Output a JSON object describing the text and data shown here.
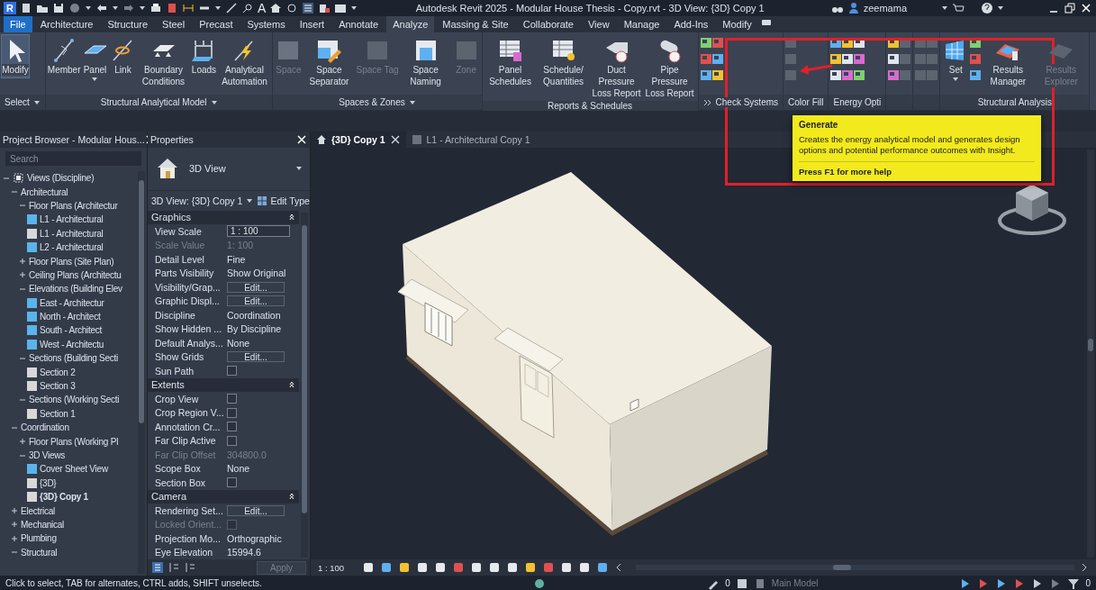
{
  "window": {
    "logo": "R",
    "text_tool": "A",
    "title": "Autodesk Revit 2025 - Modular House Thesis - Copy.rvt - 3D View: {3D} Copy 1",
    "user": "zeemama"
  },
  "menu_tabs": [
    {
      "label": "File",
      "kind": "file",
      "selected": false
    },
    {
      "label": "Architecture",
      "kind": "tab",
      "selected": false
    },
    {
      "label": "Structure",
      "kind": "tab",
      "selected": false
    },
    {
      "label": "Steel",
      "kind": "tab",
      "selected": false
    },
    {
      "label": "Precast",
      "kind": "tab",
      "selected": false
    },
    {
      "label": "Systems",
      "kind": "tab",
      "selected": false
    },
    {
      "label": "Insert",
      "kind": "tab",
      "selected": false
    },
    {
      "label": "Annotate",
      "kind": "tab",
      "selected": false
    },
    {
      "label": "Analyze",
      "kind": "tab",
      "selected": true
    },
    {
      "label": "Massing & Site",
      "kind": "tab",
      "selected": false
    },
    {
      "label": "Collaborate",
      "kind": "tab",
      "selected": false
    },
    {
      "label": "View",
      "kind": "tab",
      "selected": false
    },
    {
      "label": "Manage",
      "kind": "tab",
      "selected": false
    },
    {
      "label": "Add-Ins",
      "kind": "tab",
      "selected": false
    },
    {
      "label": "Modify",
      "kind": "tab",
      "selected": false
    }
  ],
  "ribbon": {
    "panels": [
      {
        "label": "Select",
        "menu": true,
        "expander": false,
        "items": [
          {
            "kind": "large",
            "label": "Modify",
            "selected": true,
            "disabled": false,
            "split": false
          }
        ]
      },
      {
        "label": "Structural Analytical Model",
        "menu": true,
        "expander": false,
        "items": [
          {
            "kind": "large",
            "label": "Member",
            "selected": false,
            "disabled": false,
            "split": false
          },
          {
            "kind": "large",
            "label": "Panel",
            "selected": false,
            "disabled": false,
            "split": true
          },
          {
            "kind": "large",
            "label": "Link",
            "selected": false,
            "disabled": false,
            "split": false
          },
          {
            "kind": "large",
            "label": "Boundary Conditions",
            "selected": false,
            "disabled": false,
            "split": false
          },
          {
            "kind": "large",
            "label": "Loads",
            "selected": false,
            "disabled": false,
            "split": false
          },
          {
            "kind": "large",
            "label": "Analytical Automation",
            "selected": false,
            "disabled": false,
            "split": false
          }
        ]
      },
      {
        "label": "Spaces & Zones",
        "menu": true,
        "expander": false,
        "items": [
          {
            "kind": "large",
            "label": "Space",
            "selected": false,
            "disabled": true,
            "split": false
          },
          {
            "kind": "large",
            "label": "Space Separator",
            "selected": false,
            "disabled": false,
            "split": false
          },
          {
            "kind": "large",
            "label": "Space Tag",
            "selected": false,
            "disabled": true,
            "split": false
          },
          {
            "kind": "large",
            "label": "Space Naming",
            "selected": false,
            "disabled": false,
            "split": false
          },
          {
            "kind": "large",
            "label": "Zone",
            "selected": false,
            "disabled": true,
            "split": false
          }
        ]
      },
      {
        "label": "Reports & Schedules",
        "menu": false,
        "expander": false,
        "items": [
          {
            "kind": "large",
            "label": "Panel Schedules",
            "selected": false,
            "disabled": false,
            "split": false
          },
          {
            "kind": "large",
            "label": "Schedule/ Quantities",
            "selected": false,
            "disabled": false,
            "split": false
          },
          {
            "kind": "large",
            "label": "Duct Pressure Loss Report",
            "selected": false,
            "disabled": false,
            "split": false
          },
          {
            "kind": "large",
            "label": "Pipe Pressure Loss Report",
            "selected": false,
            "disabled": false,
            "split": false
          }
        ]
      },
      {
        "label": "Check Systems",
        "menu": false,
        "expander": true,
        "items": [
          {
            "kind": "stack",
            "disabled": false
          },
          {
            "kind": "stack",
            "disabled": false
          }
        ]
      },
      {
        "label": "Color Fill",
        "menu": false,
        "expander": false,
        "items": [
          {
            "kind": "stack",
            "disabled": true
          }
        ]
      },
      {
        "label": "Energy Opti",
        "menu": false,
        "expander": false,
        "items": [
          {
            "kind": "stack",
            "disabled": false
          },
          {
            "kind": "stack",
            "disabled": false
          },
          {
            "kind": "stack",
            "disabled": false
          }
        ]
      },
      {
        "menu": false,
        "expander": false,
        "items": [
          {
            "kind": "stack",
            "disabled": false
          },
          {
            "kind": "stack",
            "disabled": true
          }
        ]
      },
      {
        "menu": false,
        "expander": false,
        "items": [
          {
            "kind": "stack",
            "disabled": true
          },
          {
            "kind": "stack",
            "disabled": true
          }
        ]
      },
      {
        "label": "Structural Analysis",
        "menu": false,
        "expander": false,
        "items": [
          {
            "kind": "large",
            "label": "Set",
            "selected": false,
            "disabled": false,
            "split": true
          },
          {
            "kind": "stack",
            "disabled": false
          },
          {
            "kind": "large",
            "label": "Results Manager",
            "selected": false,
            "disabled": false,
            "split": false
          },
          {
            "kind": "large",
            "label": "Results Explorer",
            "selected": false,
            "disabled": true,
            "split": false
          }
        ]
      }
    ]
  },
  "tooltip": {
    "title": "Generate",
    "body": "Creates the energy analytical model and generates design options and potential performance outcomes with Insight.",
    "help": "Press F1 for more help"
  },
  "project_browser": {
    "title": "Project Browser - Modular Hous...",
    "search_placeholder": "Search",
    "tree": [
      {
        "label": "Views (Discipline)",
        "expanded": true,
        "children": [
          {
            "label": "Architectural",
            "expanded": true,
            "children": [
              {
                "label": "Floor Plans (Architectur",
                "expanded": true,
                "children": [
                  {
                    "label": "L1 - Architectural",
                    "color": "#5ab4ec",
                    "active": false
                  },
                  {
                    "label": "L1 - Architectural",
                    "color": "#d8d8d8",
                    "active": false
                  },
                  {
                    "label": "L2 - Architectural",
                    "color": "#5ab4ec",
                    "active": false
                  }
                ]
              },
              {
                "label": "Floor Plans (Site Plan)",
                "expanded": false
              },
              {
                "label": "Ceiling Plans (Architectu",
                "expanded": false
              },
              {
                "label": "Elevations (Building Elev",
                "expanded": true,
                "children": [
                  {
                    "label": "East - Architectur",
                    "color": "#5ab4ec",
                    "active": false
                  },
                  {
                    "label": "North - Architect",
                    "color": "#5ab4ec",
                    "active": false
                  },
                  {
                    "label": "South - Architect",
                    "color": "#5ab4ec",
                    "active": false
                  },
                  {
                    "label": "West - Architectu",
                    "color": "#5ab4ec",
                    "active": false
                  }
                ]
              },
              {
                "label": "Sections (Building Secti",
                "expanded": true,
                "children": [
                  {
                    "label": "Section 2",
                    "color": "#d8d8d8",
                    "active": false
                  },
                  {
                    "label": "Section 3",
                    "color": "#d8d8d8",
                    "active": false
                  }
                ]
              },
              {
                "label": "Sections (Working Secti",
                "expanded": true,
                "children": [
                  {
                    "label": "Section 1",
                    "color": "#d8d8d8",
                    "active": false
                  }
                ]
              }
            ]
          },
          {
            "label": "Coordination",
            "expanded": true,
            "children": [
              {
                "label": "Floor Plans (Working Pl",
                "expanded": false
              },
              {
                "label": "3D Views",
                "expanded": true,
                "children": [
                  {
                    "label": "Cover Sheet View",
                    "color": "#5ab4ec",
                    "active": false
                  },
                  {
                    "label": "{3D}",
                    "color": "#d8d8d8",
                    "active": false
                  },
                  {
                    "label": "{3D} Copy 1",
                    "color": "#d8d8d8",
                    "active": true
                  }
                ]
              }
            ]
          },
          {
            "label": "Electrical",
            "expanded": false
          },
          {
            "label": "Mechanical",
            "expanded": false
          },
          {
            "label": "Plumbing",
            "expanded": false
          },
          {
            "label": "Structural",
            "expanded": true
          }
        ]
      }
    ]
  },
  "properties": {
    "title": "Properties",
    "type_name": "3D View",
    "instance": "3D View: {3D} Copy 1",
    "edit_type": "Edit Type",
    "groups": [
      {
        "title": "Graphics",
        "rows": [
          {
            "label": "View Scale",
            "value": "1 : 100",
            "kind": "field",
            "disabled": false
          },
          {
            "label": "Scale Value",
            "value": "1: 100",
            "kind": "text",
            "disabled": true
          },
          {
            "label": "Detail Level",
            "value": "Fine",
            "kind": "text",
            "disabled": false
          },
          {
            "label": "Parts Visibility",
            "value": "Show Original",
            "kind": "text",
            "disabled": false
          },
          {
            "label": "Visibility/Grap...",
            "value": "Edit...",
            "kind": "button",
            "disabled": false
          },
          {
            "label": "Graphic Displ...",
            "value": "Edit...",
            "kind": "button",
            "disabled": false
          },
          {
            "label": "Discipline",
            "value": "Coordination",
            "kind": "text",
            "disabled": false
          },
          {
            "label": "Show Hidden ...",
            "value": "By Discipline",
            "kind": "text",
            "disabled": false
          },
          {
            "label": "Default Analys...",
            "value": "None",
            "kind": "text",
            "disabled": false
          },
          {
            "label": "Show Grids",
            "value": "Edit...",
            "kind": "button",
            "disabled": false
          },
          {
            "label": "Sun Path",
            "kind": "checkbox",
            "checked": false,
            "disabled": false
          }
        ]
      },
      {
        "title": "Extents",
        "rows": [
          {
            "label": "Crop View",
            "kind": "checkbox",
            "checked": false,
            "disabled": false
          },
          {
            "label": "Crop Region V...",
            "kind": "checkbox",
            "checked": false,
            "disabled": false
          },
          {
            "label": "Annotation Cr...",
            "kind": "checkbox",
            "checked": false,
            "disabled": false
          },
          {
            "label": "Far Clip Active",
            "kind": "checkbox",
            "checked": false,
            "disabled": false
          },
          {
            "label": "Far Clip Offset",
            "value": "304800.0",
            "kind": "text",
            "disabled": true
          },
          {
            "label": "Scope Box",
            "value": "None",
            "kind": "text",
            "disabled": false
          },
          {
            "label": "Section Box",
            "kind": "checkbox",
            "checked": false,
            "disabled": false
          }
        ]
      },
      {
        "title": "Camera",
        "rows": [
          {
            "label": "Rendering Set...",
            "value": "Edit...",
            "kind": "button",
            "disabled": false
          },
          {
            "label": "Locked Orient...",
            "kind": "checkbox",
            "checked": false,
            "disabled": true
          },
          {
            "label": "Projection Mo...",
            "value": "Orthographic",
            "kind": "text",
            "disabled": false
          },
          {
            "label": "Eye Elevation",
            "value": "15994.6",
            "kind": "text",
            "disabled": false
          }
        ]
      }
    ],
    "apply": "Apply"
  },
  "view_tabs": [
    {
      "label": "{3D} Copy 1",
      "selected": true
    },
    {
      "label": "L1 - Architectural Copy 1",
      "selected": false
    }
  ],
  "view_bar": {
    "scale": "1 : 100"
  },
  "status_bar": {
    "message": "Click to select, TAB for alternates, CTRL adds, SHIFT unselects.",
    "workset_count": "0",
    "model": "Main Model",
    "filter_count": "0"
  }
}
